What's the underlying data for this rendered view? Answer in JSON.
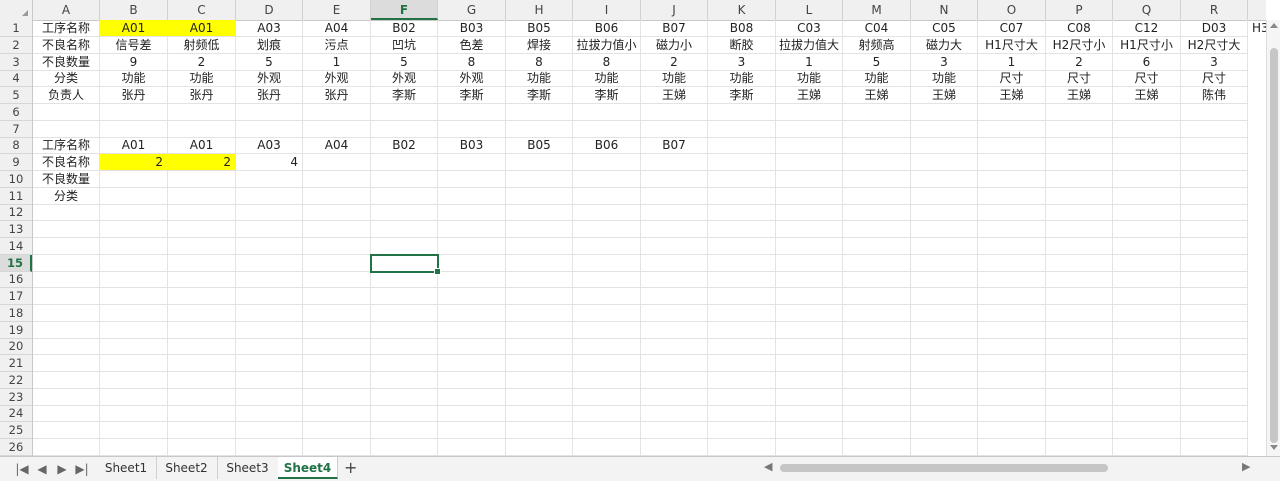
{
  "columns": [
    "A",
    "B",
    "C",
    "D",
    "E",
    "F",
    "G",
    "H",
    "I",
    "J",
    "K",
    "L",
    "M",
    "N",
    "O",
    "P",
    "Q",
    "R"
  ],
  "rows": [
    "1",
    "2",
    "3",
    "4",
    "5",
    "6",
    "7",
    "8",
    "9",
    "10",
    "11",
    "12",
    "13",
    "14",
    "15",
    "16",
    "17",
    "18",
    "19",
    "20",
    "21",
    "22",
    "23",
    "24",
    "25",
    "26"
  ],
  "selected_column": "F",
  "selected_row": "15",
  "row1": [
    "工序名称",
    "A01",
    "A01",
    "A03",
    "A04",
    "B02",
    "B03",
    "B05",
    "B06",
    "B07",
    "B08",
    "C03",
    "C04",
    "C05",
    "C07",
    "C08",
    "C12",
    "D03"
  ],
  "row2": [
    "不良名称",
    "信号差",
    "射频低",
    "划痕",
    "污点",
    "凹坑",
    "色差",
    "焊接",
    "拉拔力值小",
    "磁力小",
    "断胶",
    "拉拔力值大",
    "射频高",
    "磁力大",
    "H1尺寸大",
    "H2尺寸小",
    "H1尺寸小",
    "H2尺寸大"
  ],
  "row3": [
    "不良数量",
    "9",
    "2",
    "5",
    "1",
    "5",
    "8",
    "8",
    "8",
    "2",
    "3",
    "1",
    "5",
    "3",
    "1",
    "2",
    "6",
    "3"
  ],
  "row4": [
    "分类",
    "功能",
    "功能",
    "外观",
    "外观",
    "外观",
    "外观",
    "功能",
    "功能",
    "功能",
    "功能",
    "功能",
    "功能",
    "功能",
    "尺寸",
    "尺寸",
    "尺寸",
    "尺寸"
  ],
  "row5": [
    "负责人",
    "张丹",
    "张丹",
    "张丹",
    "张丹",
    "李斯",
    "李斯",
    "李斯",
    "李斯",
    "王娣",
    "李斯",
    "王娣",
    "王娣",
    "王娣",
    "王娣",
    "王娣",
    "王娣",
    "陈伟"
  ],
  "row1_overflow": "H3",
  "row8": [
    "工序名称",
    "A01",
    "A01",
    "A03",
    "A04",
    "B02",
    "B03",
    "B05",
    "B06",
    "B07"
  ],
  "row9": [
    "不良名称",
    "2",
    "2",
    "4"
  ],
  "row10": [
    "不良数量"
  ],
  "row11": [
    "分类"
  ],
  "highlight_color": "#ffff00",
  "accent_color": "#217346",
  "sheet_tabs": [
    "Sheet1",
    "Sheet2",
    "Sheet3",
    "Sheet4"
  ],
  "active_sheet": "Sheet4",
  "add_sheet_label": "+",
  "nav_icons": [
    "nav-first-icon",
    "nav-prev-icon",
    "nav-next-icon",
    "nav-last-icon"
  ],
  "nav_glyphs": [
    "|◀",
    "◀",
    "▶",
    "▶|"
  ]
}
